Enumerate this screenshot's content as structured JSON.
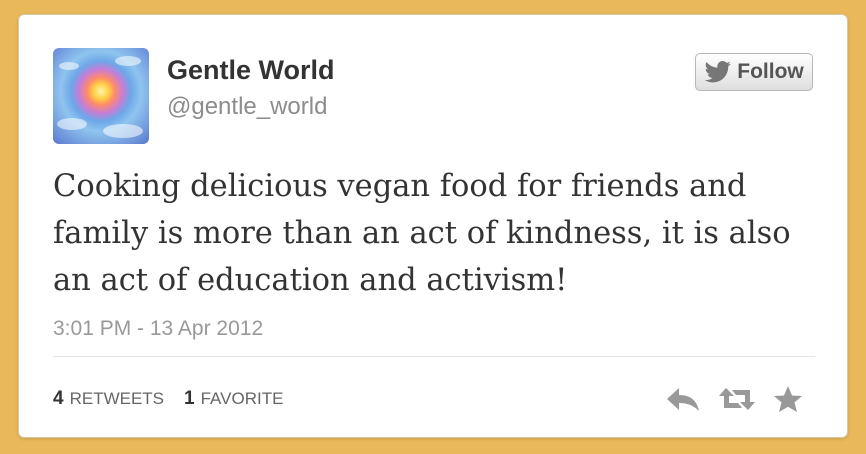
{
  "tweet": {
    "author_name": "Gentle World",
    "author_handle": "@gentle_world",
    "follow_label": "Follow",
    "text": "Cooking delicious vegan food for friends and family is more than an act of kindness, it is also an act of education and activism!",
    "timestamp": "3:01 PM - 13 Apr 2012",
    "retweet_count": "4",
    "retweet_label": "RETWEETS",
    "favorite_count": "1",
    "favorite_label": "FAVORITE"
  },
  "icons": {
    "follow": "twitter-bird-icon",
    "reply": "reply-icon",
    "retweet": "retweet-icon",
    "favorite": "star-icon"
  },
  "colors": {
    "page_background": "#e9b85a",
    "card_background": "#ffffff",
    "primary_text": "#333333",
    "secondary_text": "#8c8c8c",
    "icon_gray": "#999999"
  }
}
